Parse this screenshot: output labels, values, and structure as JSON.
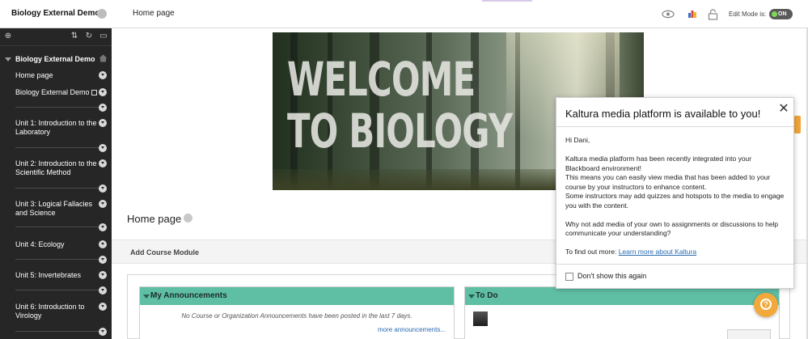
{
  "topbar": {
    "course_title": "Biology External Demo",
    "breadcrumb": "Home page",
    "edit_mode_label": "Edit Mode is:",
    "edit_mode_value": "ON"
  },
  "sidebar": {
    "course_name": "Biology External Demo",
    "items": [
      {
        "label": "Home page"
      },
      {
        "label": "Biology External Demo"
      },
      {
        "label": "Unit 1: Introduction to the Laboratory"
      },
      {
        "label": "Unit 2: Introduction to the Scientific Method"
      },
      {
        "label": "Unit 3: Logical Fallacies and Science"
      },
      {
        "label": "Unit 4: Ecology"
      },
      {
        "label": "Unit 5: Invertebrates"
      },
      {
        "label": "Unit 6: Introduction to Virology"
      }
    ]
  },
  "banner": {
    "line1": "WELCOME",
    "line2": "TO BIOLOGY"
  },
  "main": {
    "page_title": "Home page",
    "add_module": "Add Course Module",
    "announcements": {
      "title": "My Announcements",
      "text": "No Course or Organization Announcements have been posted in the last 7 days.",
      "more": "more announcements..."
    },
    "todo": {
      "title": "To Do"
    }
  },
  "kaltura": {
    "title": "Kaltura media platform is available to you!",
    "greeting": "Hi Dani,",
    "p1": "Kaltura media platform has been recently integrated into your Blackboard environment!",
    "p2": "This means you can easily view media that has been added to your course by your instructors to enhance content.",
    "p3": "Some instructors may add quizzes and hotspots to the media to engage you with the content.",
    "p4": "Why not add media of your own to assignments or discussions to help communicate your understanding?",
    "find_out_prefix": "To find out more:",
    "link": "Learn more about Kaltura",
    "dont_show": "Don't show this again"
  },
  "colors": {
    "sidebar_bg": "#262626",
    "module_header": "#5fbfa5",
    "help_button": "#f2a93b",
    "link": "#2a6bb0"
  }
}
